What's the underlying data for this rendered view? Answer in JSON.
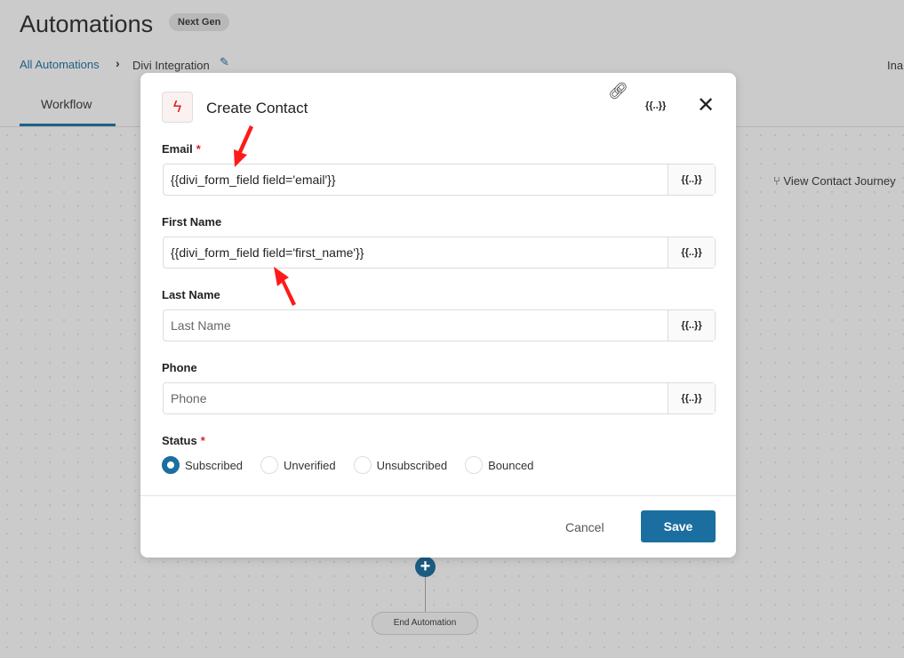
{
  "page": {
    "title": "Automations",
    "badge": "Next Gen",
    "breadcrumb": {
      "link": "All Automations",
      "current": "Divi Integration"
    },
    "status_partial": "Ina",
    "tabs": [
      {
        "label": "Workflow"
      }
    ],
    "view_journey": "View Contact Journey",
    "end_automation": "End Automation"
  },
  "modal": {
    "title": "Create Contact",
    "tag_label": "{{..}}",
    "fields": [
      {
        "label": "Email",
        "required": true,
        "value": "{{divi_form_field field='email'}}",
        "placeholder": ""
      },
      {
        "label": "First Name",
        "required": false,
        "value": "{{divi_form_field field='first_name'}}",
        "placeholder": ""
      },
      {
        "label": "Last Name",
        "required": false,
        "value": "",
        "placeholder": "Last Name"
      },
      {
        "label": "Phone",
        "required": false,
        "value": "",
        "placeholder": "Phone"
      }
    ],
    "status": {
      "label": "Status",
      "required": true,
      "options": [
        "Subscribed",
        "Unverified",
        "Unsubscribed",
        "Bounced"
      ],
      "selected": "Subscribed"
    },
    "cancel": "Cancel",
    "save": "Save"
  },
  "colors": {
    "accent": "#1b6fa0",
    "required": "#e02020",
    "arrow": "#ff1a1a"
  },
  "icons": {
    "trigger": "lightning-icon",
    "link": "link-icon",
    "close": "close-icon",
    "journey": "fork-icon",
    "edit": "pencil-icon"
  }
}
